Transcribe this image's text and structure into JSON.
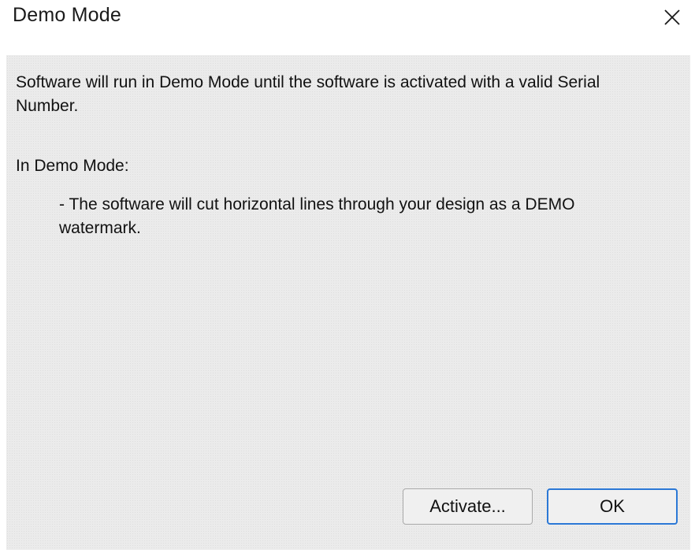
{
  "dialog": {
    "title": "Demo Mode",
    "message_line1": "Software will run in Demo Mode until the software is activated with a valid Serial Number.",
    "message_heading": "In Demo Mode:",
    "message_bullet": "- The software will cut horizontal lines through your design as a DEMO watermark.",
    "buttons": {
      "activate_label": "Activate...",
      "ok_label": "OK"
    }
  },
  "icons": {
    "close": "close-icon"
  },
  "colors": {
    "body_bg": "#ebebeb",
    "default_button_border": "#2b78d6"
  }
}
